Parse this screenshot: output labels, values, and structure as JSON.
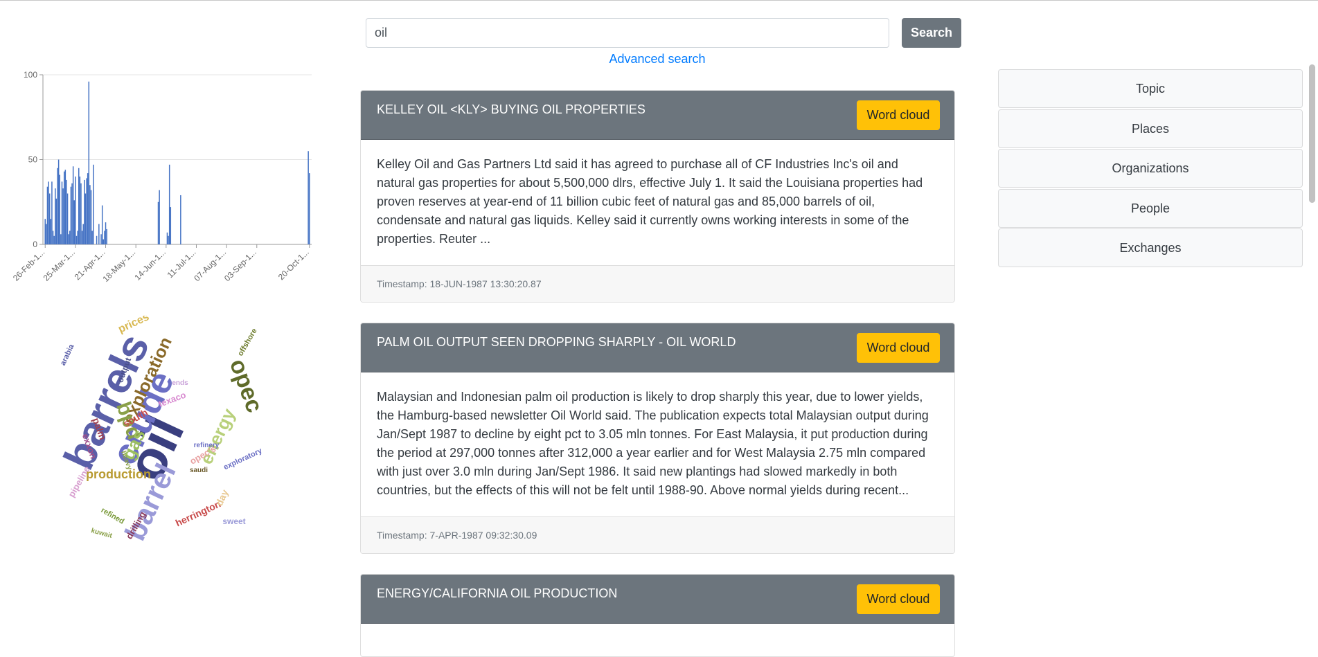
{
  "search": {
    "value": "oil",
    "button_label": "Search",
    "advanced_label": "Advanced search"
  },
  "results": [
    {
      "title": "KELLEY OIL <KLY> BUYING OIL PROPERTIES",
      "button_label": "Word cloud",
      "body": "Kelley Oil and Gas Partners Ltd said it has agreed to purchase all of CF Industries Inc's oil and natural gas properties for about 5,500,000 dlrs, effective July 1. It said the Louisiana properties had proven reserves at year-end of 11 billion cubic feet of natural gas and 85,000 barrels of oil, condensate and natural gas liquids. Kelley said it currently owns working interests in some of the properties. Reuter ...",
      "timestamp": "Timestamp: 18-JUN-1987 13:30:20.87"
    },
    {
      "title": "PALM OIL OUTPUT SEEN DROPPING SHARPLY - OIL WORLD",
      "button_label": "Word cloud",
      "body": "Malaysian and Indonesian palm oil production is likely to drop sharply this year, due to lower yields, the Hamburg-based newsletter Oil World said. The publication expects total Malaysian output during Jan/Sept 1987 to decline by eight pct to 3.05 mln tonnes. For East Malaysia, it put production during the period at 297,000 tonnes after 312,000 a year earlier and for West Malaysia 2.75 mln compared with just over 3.0 mln during Jan/Sept 1986. It said new plantings had slowed markedly in both countries, but the effects of this will not be felt until 1988-90. Above normal yields during recent...",
      "timestamp": "Timestamp: 7-APR-1987 09:32:30.09"
    },
    {
      "title": "ENERGY/CALIFORNIA OIL PRODUCTION",
      "button_label": "Word cloud"
    }
  ],
  "facets": {
    "topic": "Topic",
    "places": "Places",
    "organizations": "Organizations",
    "people": "People",
    "exchanges": "Exchanges"
  },
  "colors": {
    "header_gray": "#6c757d",
    "accent_yellow": "#ffc107",
    "link_blue": "#007bff",
    "bar_blue": "#4472c4"
  },
  "chart_data": {
    "type": "bar",
    "title": "",
    "xlabel": "",
    "ylabel": "",
    "ylim": [
      0,
      100
    ],
    "yticks": [
      0,
      50,
      100
    ],
    "grid": true,
    "xlim": [
      "1987-02-24",
      "1987-10-22"
    ],
    "tick_dates": [
      "1987-02-26",
      "1987-03-25",
      "1987-04-21",
      "1987-05-18",
      "1987-06-14",
      "1987-07-11",
      "1987-08-07",
      "1987-09-03",
      "1987-10-20"
    ],
    "tick_labels": [
      "26-Feb-1...",
      "25-Mar-1...",
      "21-Apr-1...",
      "18-May-1...",
      "14-Jun-1...",
      "11-Jul-1...",
      "07-Aug-1...",
      "03-Sep-1...",
      "20-Oct-1..."
    ],
    "points": [
      [
        "1987-02-26",
        15
      ],
      [
        "1987-02-27",
        12
      ],
      [
        "1987-02-28",
        34
      ],
      [
        "1987-03-01",
        37
      ],
      [
        "1987-03-02",
        30
      ],
      [
        "1987-03-03",
        15
      ],
      [
        "1987-03-04",
        37
      ],
      [
        "1987-03-05",
        8
      ],
      [
        "1987-03-06",
        5
      ],
      [
        "1987-03-07",
        33
      ],
      [
        "1987-03-08",
        27
      ],
      [
        "1987-03-09",
        45
      ],
      [
        "1987-03-10",
        50
      ],
      [
        "1987-03-11",
        41
      ],
      [
        "1987-03-12",
        6
      ],
      [
        "1987-03-13",
        37
      ],
      [
        "1987-03-14",
        33
      ],
      [
        "1987-03-15",
        43
      ],
      [
        "1987-03-16",
        44
      ],
      [
        "1987-03-17",
        38
      ],
      [
        "1987-03-18",
        30
      ],
      [
        "1987-03-19",
        6
      ],
      [
        "1987-03-20",
        8
      ],
      [
        "1987-03-21",
        34
      ],
      [
        "1987-03-22",
        36
      ],
      [
        "1987-03-23",
        46
      ],
      [
        "1987-03-24",
        26
      ],
      [
        "1987-03-25",
        40
      ],
      [
        "1987-03-26",
        5
      ],
      [
        "1987-03-27",
        8
      ],
      [
        "1987-03-28",
        45
      ],
      [
        "1987-03-29",
        40
      ],
      [
        "1987-03-30",
        36
      ],
      [
        "1987-03-31",
        8
      ],
      [
        "1987-04-01",
        12
      ],
      [
        "1987-04-02",
        38
      ],
      [
        "1987-04-03",
        30
      ],
      [
        "1987-04-04",
        39
      ],
      [
        "1987-04-05",
        42
      ],
      [
        "1987-04-06",
        96
      ],
      [
        "1987-04-07",
        35
      ],
      [
        "1987-04-08",
        32
      ],
      [
        "1987-04-09",
        8
      ],
      [
        "1987-04-10",
        47
      ],
      [
        "1987-04-13",
        5
      ],
      [
        "1987-04-15",
        12
      ],
      [
        "1987-04-17",
        6
      ],
      [
        "1987-04-18",
        23
      ],
      [
        "1987-04-19",
        3
      ],
      [
        "1987-04-20",
        8
      ],
      [
        "1987-04-21",
        13
      ],
      [
        "1987-04-22",
        9
      ],
      [
        "1987-06-07",
        25
      ],
      [
        "1987-06-08",
        32
      ],
      [
        "1987-06-15",
        7
      ],
      [
        "1987-06-16",
        5
      ],
      [
        "1987-06-17",
        47
      ],
      [
        "1987-06-18",
        22
      ],
      [
        "1987-06-27",
        29
      ],
      [
        "1987-10-19",
        55
      ],
      [
        "1987-10-20",
        42
      ]
    ]
  },
  "word_cloud": [
    {
      "text": "oil",
      "color": "#3a3f7f"
    },
    {
      "text": "barrels",
      "color": "#5a5fa8"
    },
    {
      "text": "crude",
      "color": "#6b6fc4"
    },
    {
      "text": "opec",
      "color": "#5f6b2a"
    },
    {
      "text": "exploration",
      "color": "#8a6a2a"
    },
    {
      "text": "barrel",
      "color": "#9a9ad8"
    },
    {
      "text": "bpd",
      "color": "#8aa048"
    },
    {
      "text": "energy",
      "color": "#b8d07a"
    },
    {
      "text": "gas",
      "color": "#9cc060"
    },
    {
      "text": "production",
      "color": "#b89a30"
    },
    {
      "text": "prices",
      "color": "#d8b850"
    },
    {
      "text": "output",
      "color": "#4a4f8a"
    },
    {
      "text": "arabia",
      "color": "#5a5fa8"
    },
    {
      "text": "offshore",
      "color": "#6b7a2a"
    },
    {
      "text": "exploratory",
      "color": "#6b6fc4"
    },
    {
      "text": "herrington",
      "color": "#c84a4a"
    },
    {
      "text": "drilling",
      "color": "#8a3a5a"
    },
    {
      "text": "pipeline",
      "color": "#d8a0d0"
    },
    {
      "text": "exxon",
      "color": "#a0508a"
    },
    {
      "text": "palm",
      "color": "#a04050"
    },
    {
      "text": "saudi",
      "color": "#6b5a2a"
    },
    {
      "text": "kuwait",
      "color": "#8aa048"
    },
    {
      "text": "refined",
      "color": "#7a9a3a"
    },
    {
      "text": "sweet",
      "color": "#9a9ad8"
    },
    {
      "text": "day",
      "color": "#e8c890"
    },
    {
      "text": "texaco",
      "color": "#d88ad0"
    },
    {
      "text": "south",
      "color": "#c84a4a"
    },
    {
      "text": "opec's",
      "color": "#e8a0a0"
    },
    {
      "text": "heavy",
      "color": "#8aa048"
    },
    {
      "text": "ends",
      "color": "#c8a0d8"
    },
    {
      "text": "refinery",
      "color": "#6b6fc4"
    }
  ]
}
